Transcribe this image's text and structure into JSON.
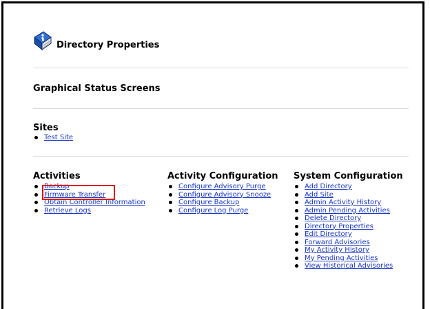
{
  "page_title": "Directory Properties",
  "sections": {
    "graphical_status": "Graphical Status Screens",
    "sites": {
      "heading": "Sites",
      "items": [
        "Test Site"
      ]
    }
  },
  "columns": {
    "activities": {
      "heading": "Activities",
      "items": [
        "Backup",
        "Firmware Transfer",
        "Obtain Controller Information",
        "Retrieve Logs"
      ]
    },
    "activity_configuration": {
      "heading": "Activity Configuration",
      "items": [
        "Configure Advisory Purge",
        "Configure Advisory Snooze",
        "Configure Backup",
        "Configure Log Purge"
      ]
    },
    "system_configuration": {
      "heading": "System Configuration",
      "items": [
        "Add Directory",
        "Add Site",
        "Admin Activity History",
        "Admin Pending Activities",
        "Delete Directory",
        "Directory Properties",
        "Edit Directory",
        "Forward Advisories",
        "My Activity History",
        "My Pending Activities",
        "View Historical Advisories"
      ]
    }
  },
  "icons": {
    "title_icon": "directory-book-icon"
  },
  "colors": {
    "link": "#1a37c8",
    "highlight": "#e00000"
  }
}
